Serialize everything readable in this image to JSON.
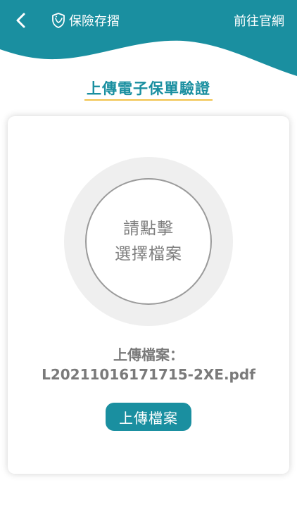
{
  "header": {
    "app_title": "保險存摺",
    "website_link": "前往官網"
  },
  "page": {
    "title": "上傳電子保單驗證"
  },
  "upload_card": {
    "select_prompt_line1": "請點擊",
    "select_prompt_line2": "選擇檔案",
    "file_label": "上傳檔案：",
    "file_name": "L20211016171715-2XE.pdf",
    "upload_button": "上傳檔案"
  },
  "colors": {
    "brand_teal": "#1a8fa0",
    "underline_yellow": "#f1c24b",
    "text_gray": "#7a7a7a",
    "circle_bg": "#efefef"
  },
  "icons": {
    "back": "back-chevron-icon",
    "app_logo": "shield-logo-icon"
  }
}
